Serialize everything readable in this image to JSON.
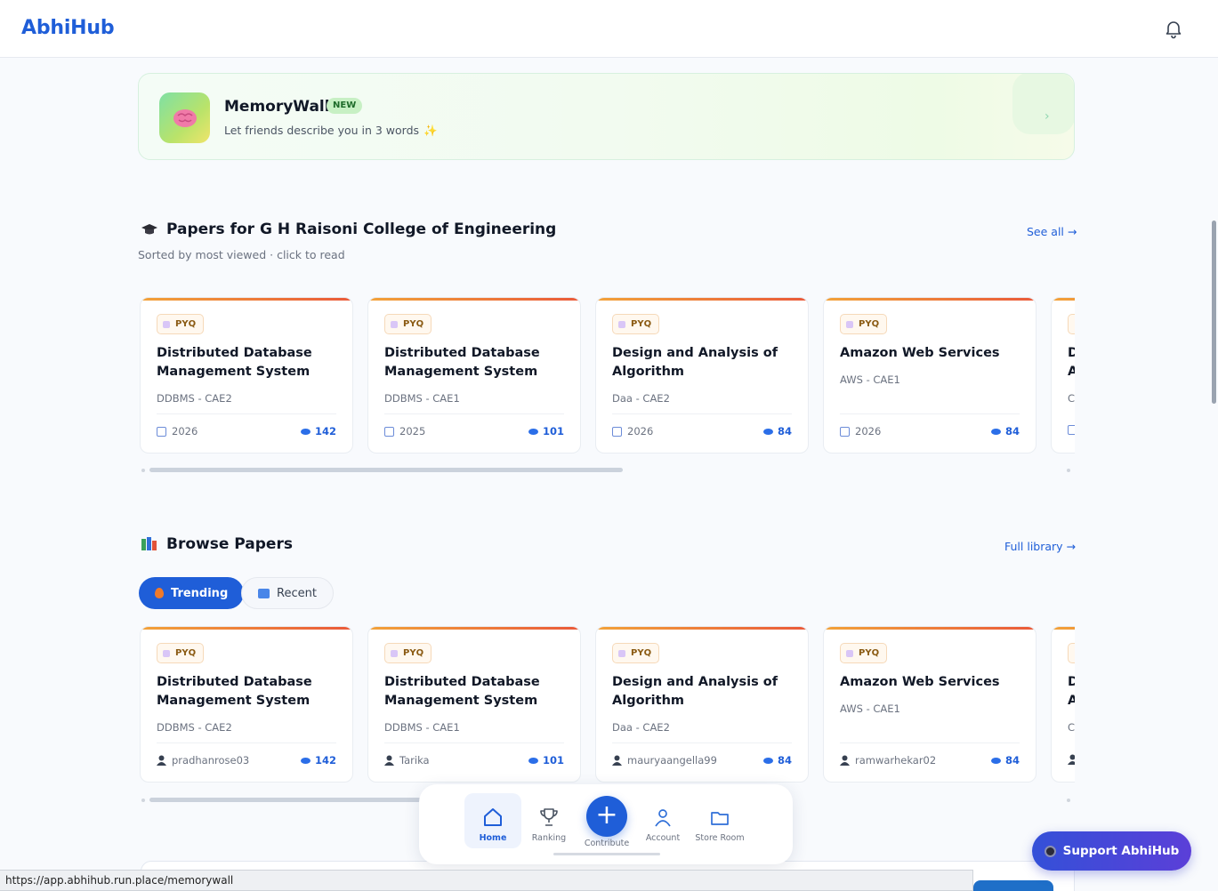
{
  "header": {
    "brand": "AbhiHub",
    "notification_icon": "bell-icon"
  },
  "memorywall": {
    "title": "MemoryWall",
    "badge": "NEW",
    "subtitle": "Let friends describe you in 3 words",
    "icon": "brain-icon",
    "sparkle": "✨",
    "arrow": "›"
  },
  "papers_section": {
    "title": "Papers for G H Raisoni College of Engineering",
    "icon": "graduation-cap-icon",
    "subtitle": "Sorted by most viewed · click to read",
    "link": "See all →",
    "cards": [
      {
        "tag": "PYQ",
        "title": "Distributed Database Management System",
        "code": "DDBMS - CAE2",
        "year": "2026",
        "views": "142"
      },
      {
        "tag": "PYQ",
        "title": "Distributed Database Management System",
        "code": "DDBMS - CAE1",
        "year": "2025",
        "views": "101"
      },
      {
        "tag": "PYQ",
        "title": "Design and Analysis of Algorithm",
        "code": "Daa - CAE2",
        "year": "2026",
        "views": "84"
      },
      {
        "tag": "PYQ",
        "title": "Amazon Web Services",
        "code": "AWS - CAE1",
        "year": "2026",
        "views": "84"
      },
      {
        "tag": "",
        "title": "D A",
        "code": "C",
        "year": "",
        "views": ""
      }
    ]
  },
  "browse_section": {
    "title": "Browse Papers",
    "icon": "books-icon",
    "link": "Full library →",
    "tabs": [
      {
        "label": "Trending",
        "icon": "fire-icon",
        "active": true
      },
      {
        "label": "Recent",
        "icon": "new-icon",
        "active": false
      }
    ],
    "cards": [
      {
        "tag": "PYQ",
        "title": "Distributed Database Management System",
        "code": "DDBMS - CAE2",
        "user": "pradhanrose03",
        "views": "142"
      },
      {
        "tag": "PYQ",
        "title": "Distributed Database Management System",
        "code": "DDBMS - CAE1",
        "user": "Tarika",
        "views": "101"
      },
      {
        "tag": "PYQ",
        "title": "Design and Analysis of Algorithm",
        "code": "Daa - CAE2",
        "user": "mauryaangella99",
        "views": "84"
      },
      {
        "tag": "PYQ",
        "title": "Amazon Web Services",
        "code": "AWS - CAE1",
        "user": "ramwarhekar02",
        "views": "84"
      },
      {
        "tag": "",
        "title": "D A",
        "code": "C",
        "user": "",
        "views": ""
      }
    ]
  },
  "bottom_nav": {
    "items": [
      {
        "label": "Home",
        "icon": "home-icon",
        "active": true
      },
      {
        "label": "Ranking",
        "icon": "trophy-icon",
        "active": false
      },
      {
        "label": "Contribute",
        "icon": "plus-icon",
        "active": false
      },
      {
        "label": "Account",
        "icon": "user-icon",
        "active": false
      },
      {
        "label": "Store Room",
        "icon": "folder-icon",
        "active": false
      }
    ],
    "plus": "+"
  },
  "support_button": {
    "label": "Support AbhiHub",
    "icon": "coffee-icon"
  },
  "status_url": "https://app.abhihub.run.place/memorywall",
  "colors": {
    "accent": "#1f5ed8",
    "card_top": "#ea5a3a"
  }
}
